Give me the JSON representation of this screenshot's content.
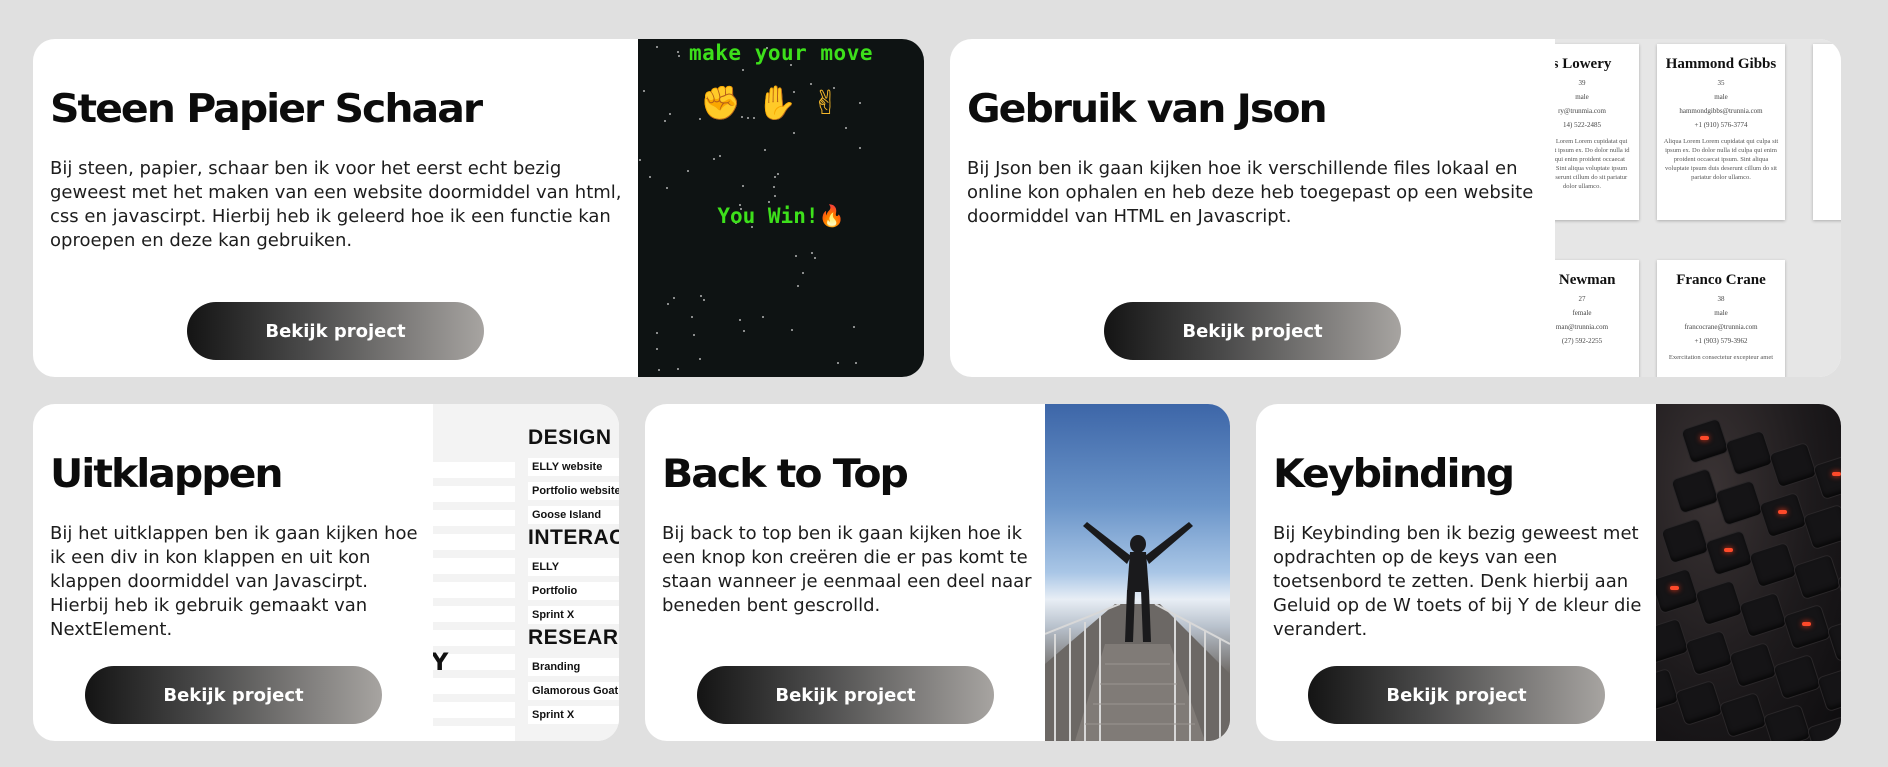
{
  "projects": [
    {
      "title": "Steen Papier Schaar",
      "description": "Bij steen, papier, schaar ben ik voor het eerst echt bezig geweest met het maken van een website doormiddel van html, css en javascirpt. Hierbij heb ik geleerd hoe ik een functie kan oproepen en deze kan gebruiken.",
      "button": "Bekijk project",
      "image": {
        "heading": "make your move",
        "hands": [
          "✊",
          "✋",
          "✌"
        ],
        "result": "You Win!🔥"
      }
    },
    {
      "title": "Gebruik van Json",
      "description": "Bij Json ben ik gaan kijken hoe ik verschillende files lokaal en online kon ophalen en heb deze heb toegepast op een website doormiddel van HTML en Javascript.",
      "button": "Bekijk project",
      "image": {
        "people": [
          {
            "name": "s Lowery",
            "age": "39",
            "gender": "male",
            "email": "ry@trunmia.com",
            "phone": "14) 522-2485"
          },
          {
            "name": "Hammond Gibbs",
            "age": "35",
            "gender": "male",
            "email": "hammondgibbs@trunnia.com",
            "phone": "+1 (910) 576-3774"
          },
          {
            "name": "e Newman",
            "age": "27",
            "gender": "female",
            "email": "man@trunnia.com",
            "phone": "(27) 592-2255"
          },
          {
            "name": "Franco Crane",
            "age": "38",
            "gender": "male",
            "email": "francocrane@trunnia.com",
            "phone": "+1 (903) 579-3962"
          }
        ],
        "bio_text": "Aliqua Lorem Lorem cupidatat qui culpa sit ipsum ex. Do dolor nulla id culpa qui enim proident occaecat ipsum. Sint aliqua voluptate ipsum duis deserunt cillum do sit pariatur dolor ullamco.",
        "bio_text_2": "Exercitation consectetur excepteur amet"
      }
    },
    {
      "title": "Uitklappen",
      "description": "Bij het uitklappen ben ik gaan kijken hoe ik een div in kon klappen en uit kon klappen doormiddel van Javascirpt. Hierbij heb ik gebruik gemaakt van NextElement.",
      "button": "Bekijk project",
      "image": {
        "sections": [
          {
            "heading": "DESIGN",
            "items": [
              "ELLY website",
              "Portfolio website",
              "Goose Island"
            ]
          },
          {
            "heading": "INTERAC",
            "items": [
              "ELLY",
              "Portfolio",
              "Sprint X"
            ]
          },
          {
            "heading": "RESEARC",
            "items": [
              "Branding",
              "Glamorous Goat",
              "Sprint X"
            ]
          }
        ],
        "side_mark": "Y"
      }
    },
    {
      "title": "Back to Top",
      "description": "Bij back to top ben ik gaan kijken hoe ik een knop kon creëren die er pas komt te staan wanneer je eenmaal een deel naar beneden bent gescrolld.",
      "button": "Bekijk project"
    },
    {
      "title": "Keybinding",
      "description": "Bij Keybinding ben ik bezig geweest met opdrachten op de keys van een toetsenbord te zetten. Denk hierbij aan Geluid op de W toets of bij Y de kleur die verandert.",
      "button": "Bekijk project"
    }
  ],
  "colors": {
    "page_background": "#e0e0e0",
    "card_background": "#ffffff",
    "button_gradient_start": "#141414",
    "button_gradient_end": "#a7a4a1",
    "game_green": "#3de01b"
  }
}
